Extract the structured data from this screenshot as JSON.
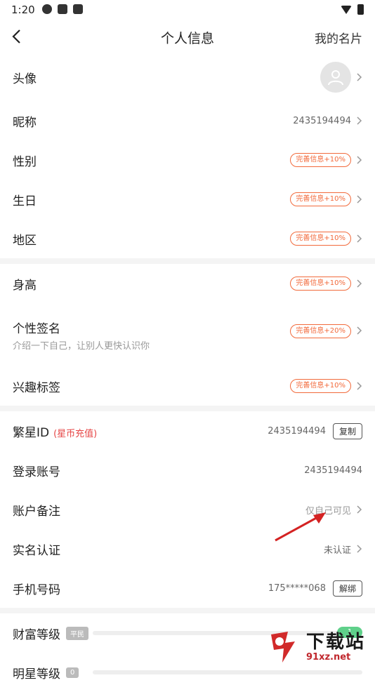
{
  "status": {
    "time": "1:20"
  },
  "nav": {
    "title": "个人信息",
    "right": "我的名片"
  },
  "section1": [
    {
      "label": "头像",
      "type": "avatar"
    },
    {
      "label": "昵称",
      "value": "2435194494"
    },
    {
      "label": "性别",
      "badge": "完善信息+10%"
    },
    {
      "label": "生日",
      "badge": "完善信息+10%"
    },
    {
      "label": "地区",
      "badge": "完善信息+10%"
    }
  ],
  "section2": [
    {
      "label": "身高",
      "badge": "完善信息+10%"
    },
    {
      "label": "个性签名",
      "badge": "完善信息+20%",
      "sub": "介绍一下自己，让别人更快认识你"
    },
    {
      "label": "兴趣标签",
      "badge": "完善信息+10%"
    }
  ],
  "section3": {
    "id": {
      "label": "繁星ID",
      "recharge": "(星币充值)",
      "value": "2435194494",
      "button": "复制"
    },
    "account": {
      "label": "登录账号",
      "value": "2435194494"
    },
    "remark": {
      "label": "账户备注",
      "value": "仅自己可见"
    },
    "realname": {
      "label": "实名认证",
      "value": "未认证"
    },
    "phone": {
      "label": "手机号码",
      "value": "175*****068",
      "button": "解绑"
    }
  },
  "section4": {
    "wealth": {
      "label": "财富等级",
      "tag": "平民",
      "level": "1"
    },
    "star": {
      "label": "明星等级",
      "tag": "0"
    }
  },
  "watermark": {
    "big": "下载站",
    "small": "91xz.net"
  },
  "colors": {
    "accent": "#f26a3b",
    "recharge": "#e64545",
    "arrow": "#d42222"
  }
}
